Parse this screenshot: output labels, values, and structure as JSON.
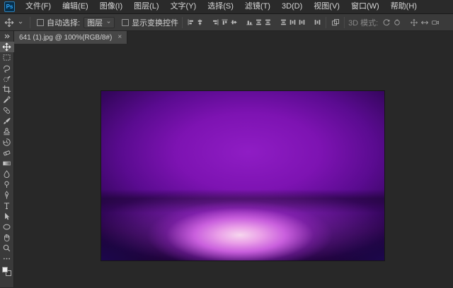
{
  "theme": {
    "menubar_bg": "#2a2a2a",
    "panel_bg": "#3a3a3a",
    "workspace_bg": "#282828",
    "tab_active_bg": "#474747",
    "text": "#d6d6d6",
    "logo_bg": "#06304d",
    "logo_text": "#31a8ff",
    "image_wall": "#8f1dc4",
    "image_wall_dark": "#1c0336",
    "image_floor": "#c95fdd",
    "image_floor_glow": "#f6d6ee"
  },
  "menubar": {
    "logo_text": "Ps",
    "items": [
      {
        "name": "menu-item-file",
        "label": "文件(F)"
      },
      {
        "name": "menu-item-edit",
        "label": "编辑(E)"
      },
      {
        "name": "menu-item-image",
        "label": "图像(I)"
      },
      {
        "name": "menu-item-layer",
        "label": "图层(L)"
      },
      {
        "name": "menu-item-type",
        "label": "文字(Y)"
      },
      {
        "name": "menu-item-select",
        "label": "选择(S)"
      },
      {
        "name": "menu-item-filter",
        "label": "滤镜(T)"
      },
      {
        "name": "menu-item-3d",
        "label": "3D(D)"
      },
      {
        "name": "menu-item-view",
        "label": "视图(V)"
      },
      {
        "name": "menu-item-window",
        "label": "窗口(W)"
      },
      {
        "name": "menu-item-help",
        "label": "帮助(H)"
      }
    ]
  },
  "optionsbar": {
    "auto_select_label": "自动选择:",
    "layer_dropdown_value": "图层",
    "show_transform_label": "显示变换控件",
    "mode_label": "3D 模式:",
    "align_icons": [
      {
        "name": "align-left-icon",
        "icon": "i-align-left"
      },
      {
        "name": "align-horizontal-center-icon",
        "icon": "i-align-hcenter"
      },
      {
        "name": "align-right-icon",
        "icon": "i-align-right"
      },
      {
        "name": "align-top-icon",
        "icon": "i-align-top"
      },
      {
        "name": "align-vertical-center-icon",
        "icon": "i-align-vcenter"
      },
      {
        "name": "align-bottom-icon",
        "icon": "i-align-bottom"
      },
      {
        "name": "distribute-top-icon",
        "icon": "i-dist-h"
      },
      {
        "name": "distribute-vertical-center-icon",
        "icon": "i-dist-h"
      },
      {
        "name": "distribute-bottom-icon",
        "icon": "i-dist-h"
      },
      {
        "name": "distribute-left-icon",
        "icon": "i-dist-v"
      },
      {
        "name": "distribute-horizontal-center-icon",
        "icon": "i-dist-v"
      },
      {
        "name": "distribute-right-icon",
        "icon": "i-dist-v"
      }
    ],
    "mode_icons": [
      {
        "name": "3d-orbit-icon",
        "icon": "i-3d-orbit"
      },
      {
        "name": "3d-roll-icon",
        "icon": "i-3d-roll"
      },
      {
        "name": "3d-pan-icon",
        "icon": "i-3d-pan"
      },
      {
        "name": "3d-slide-icon",
        "icon": "i-3d-slide"
      },
      {
        "name": "3d-camera-icon",
        "icon": "i-3d-cam"
      }
    ]
  },
  "tabbar": {
    "tabs": [
      {
        "title": "641 (1).jpg @ 100%(RGB/8#)",
        "close_glyph": "×",
        "active": true
      }
    ]
  },
  "toolbar": {
    "tools": [
      {
        "name": "collapse-tools-button",
        "icon": "i-collapse"
      },
      {
        "name": "move-tool",
        "icon": "i-move",
        "active": true
      },
      {
        "name": "marquee-tool",
        "icon": "i-marquee"
      },
      {
        "name": "lasso-tool",
        "icon": "i-lasso"
      },
      {
        "name": "quick-selection-tool",
        "icon": "i-quickselect"
      },
      {
        "name": "crop-tool",
        "icon": "i-crop"
      },
      {
        "name": "eyedropper-tool",
        "icon": "i-eyedropper"
      },
      {
        "name": "healing-brush-tool",
        "icon": "i-heal"
      },
      {
        "name": "brush-tool",
        "icon": "i-brush"
      },
      {
        "name": "clone-stamp-tool",
        "icon": "i-stamp"
      },
      {
        "name": "history-brush-tool",
        "icon": "i-history"
      },
      {
        "name": "eraser-tool",
        "icon": "i-eraser"
      },
      {
        "name": "gradient-tool",
        "icon": "i-gradient"
      },
      {
        "name": "blur-tool",
        "icon": "i-blur"
      },
      {
        "name": "dodge-tool",
        "icon": "i-dodge"
      },
      {
        "name": "pen-tool",
        "icon": "i-pen"
      },
      {
        "name": "type-tool",
        "icon": "i-type"
      },
      {
        "name": "path-selection-tool",
        "icon": "i-arrow"
      },
      {
        "name": "shape-tool",
        "icon": "i-shape"
      },
      {
        "name": "hand-tool",
        "icon": "i-hand"
      },
      {
        "name": "zoom-tool",
        "icon": "i-zoom"
      },
      {
        "name": "edit-toolbar-button",
        "icon": "i-ellipsis"
      }
    ],
    "swatches": {
      "foreground": "#ececec",
      "background": "#303030"
    }
  },
  "canvas": {
    "image_description": "purple studio backdrop with bright center glow"
  }
}
